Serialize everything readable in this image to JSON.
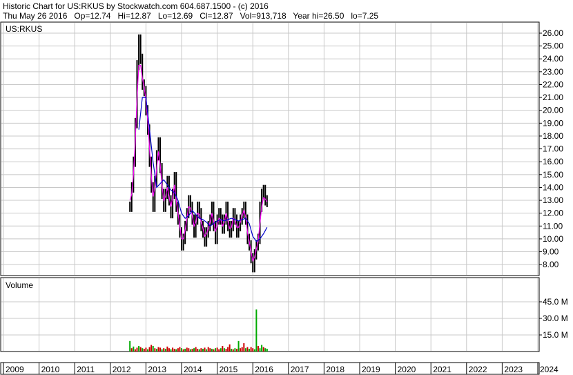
{
  "header": {
    "line1": "Historic Chart for US:RKUS by Stockwatch.com 604.687.1500 - (c) 2016",
    "line2": "Thu May 26 2016   Op=12.74   Hi=12.87   Lo=12.69   Cl=12.87   Vol=913,718   Year hi=26.50   lo=7.25"
  },
  "colors": {
    "grid": "#c8c8c8",
    "price_bars": "#000000",
    "ma_short": "#ff00ff",
    "ma_long": "#0000cc",
    "volume_up": "#00aa00",
    "volume_down": "#cc0000"
  },
  "chart_data": [
    {
      "type": "line",
      "title": "US:RKUS",
      "ylim": [
        7,
        26.8
      ],
      "y_ticks": [
        "26.00",
        "25.00",
        "24.00",
        "23.00",
        "22.00",
        "21.00",
        "20.00",
        "19.00",
        "18.00",
        "17.00",
        "16.00",
        "15.00",
        "14.00",
        "13.00",
        "12.00",
        "11.00",
        "10.00",
        "9.00",
        "8.00"
      ],
      "x_ticks": [
        "2009",
        "2010",
        "2011",
        "2012",
        "2013",
        "2014",
        "2015",
        "2016",
        "2017",
        "2018",
        "2019",
        "2020",
        "2021",
        "2022",
        "2023",
        "2024"
      ],
      "grid": true,
      "series": [
        {
          "kind": "price",
          "x": [
            2012.55,
            2012.6,
            2012.65,
            2012.7,
            2012.75,
            2012.8,
            2012.85,
            2012.9,
            2012.95,
            2013.0,
            2013.05,
            2013.1,
            2013.15,
            2013.2,
            2013.25,
            2013.3,
            2013.35,
            2013.4,
            2013.45,
            2013.5,
            2013.55,
            2013.6,
            2013.65,
            2013.7,
            2013.75,
            2013.8,
            2013.85,
            2013.9,
            2013.95,
            2014.0,
            2014.05,
            2014.1,
            2014.15,
            2014.2,
            2014.25,
            2014.3,
            2014.35,
            2014.4,
            2014.45,
            2014.5,
            2014.55,
            2014.6,
            2014.65,
            2014.7,
            2014.75,
            2014.8,
            2014.85,
            2014.9,
            2014.95,
            2015.0,
            2015.05,
            2015.1,
            2015.15,
            2015.2,
            2015.25,
            2015.3,
            2015.35,
            2015.4,
            2015.45,
            2015.5,
            2015.55,
            2015.6,
            2015.65,
            2015.7,
            2015.75,
            2015.8,
            2015.85,
            2015.9,
            2015.95,
            2016.0,
            2016.05,
            2016.1,
            2016.15,
            2016.2,
            2016.25,
            2016.3,
            2016.35,
            2016.4
          ],
          "y": [
            12.5,
            14.0,
            16.0,
            19.0,
            23.5,
            25.5,
            24.0,
            22.0,
            21.5,
            20.0,
            18.5,
            16.0,
            14.0,
            12.5,
            14.5,
            16.5,
            17.5,
            15.5,
            13.5,
            12.5,
            13.5,
            14.5,
            13.0,
            12.0,
            13.5,
            14.8,
            12.5,
            11.5,
            10.5,
            9.5,
            10.0,
            11.0,
            12.0,
            13.0,
            12.5,
            11.5,
            10.5,
            11.5,
            12.5,
            12.0,
            11.0,
            10.5,
            9.8,
            10.5,
            11.0,
            11.5,
            12.5,
            11.0,
            10.0,
            11.5,
            12.0,
            11.5,
            10.8,
            11.5,
            12.5,
            11.0,
            10.5,
            11.0,
            12.0,
            11.5,
            10.5,
            11.0,
            11.5,
            12.0,
            12.5,
            11.5,
            10.0,
            9.5,
            8.5,
            7.8,
            8.8,
            9.5,
            10.0,
            12.5,
            13.5,
            13.8,
            13.0,
            12.87
          ]
        },
        {
          "kind": "ma_short",
          "x": [
            2012.55,
            2012.6,
            2012.65,
            2012.7,
            2012.75,
            2012.8,
            2012.85,
            2012.9,
            2012.95,
            2013.0,
            2013.05,
            2013.1,
            2013.15,
            2013.2,
            2013.25,
            2013.3,
            2013.35,
            2013.4,
            2013.45,
            2013.5,
            2013.55,
            2013.6,
            2013.65,
            2013.7,
            2013.75,
            2013.8,
            2013.85,
            2013.9,
            2013.95,
            2014.0,
            2014.05,
            2014.1,
            2014.15,
            2014.2,
            2014.25,
            2014.3,
            2014.35,
            2014.4,
            2014.45,
            2014.5,
            2014.55,
            2014.6,
            2014.65,
            2014.7,
            2014.75,
            2014.8,
            2014.85,
            2014.9,
            2014.95,
            2015.0,
            2015.05,
            2015.1,
            2015.15,
            2015.2,
            2015.25,
            2015.3,
            2015.35,
            2015.4,
            2015.45,
            2015.5,
            2015.55,
            2015.6,
            2015.65,
            2015.7,
            2015.75,
            2015.8,
            2015.85,
            2015.9,
            2015.95,
            2016.0,
            2016.05,
            2016.1,
            2016.15,
            2016.2,
            2016.25,
            2016.3,
            2016.35,
            2016.4
          ],
          "y": [
            13.0,
            13.5,
            15.0,
            17.5,
            21.0,
            23.5,
            23.5,
            22.5,
            21.8,
            20.8,
            19.2,
            17.0,
            15.0,
            13.3,
            14.0,
            15.5,
            16.8,
            15.8,
            14.2,
            13.0,
            13.3,
            14.0,
            13.3,
            12.5,
            13.2,
            14.2,
            13.0,
            12.0,
            11.0,
            10.0,
            10.0,
            10.7,
            11.6,
            12.5,
            12.4,
            11.8,
            11.0,
            11.3,
            12.0,
            11.9,
            11.3,
            10.8,
            10.2,
            10.4,
            10.8,
            11.3,
            12.0,
            11.4,
            10.6,
            11.0,
            11.6,
            11.5,
            11.0,
            11.3,
            12.0,
            11.4,
            10.8,
            10.9,
            11.6,
            11.5,
            10.9,
            10.9,
            11.3,
            11.8,
            12.2,
            11.7,
            10.5,
            9.8,
            9.0,
            8.3,
            8.6,
            9.2,
            9.8,
            11.2,
            12.5,
            13.2,
            13.1,
            12.9
          ]
        },
        {
          "kind": "ma_long",
          "x": [
            2012.8,
            2012.9,
            2013.0,
            2013.1,
            2013.2,
            2013.3,
            2013.4,
            2013.5,
            2013.6,
            2013.7,
            2013.8,
            2013.9,
            2014.0,
            2014.1,
            2014.2,
            2014.3,
            2014.4,
            2014.5,
            2014.6,
            2014.7,
            2014.8,
            2014.9,
            2015.0,
            2015.1,
            2015.2,
            2015.3,
            2015.4,
            2015.5,
            2015.6,
            2015.7,
            2015.8,
            2015.9,
            2016.0,
            2016.1,
            2016.2,
            2016.3,
            2016.4
          ],
          "y": [
            18.5,
            21.0,
            21.0,
            18.5,
            16.0,
            14.0,
            14.3,
            14.6,
            14.2,
            13.8,
            13.6,
            13.0,
            12.0,
            11.6,
            11.8,
            12.2,
            11.9,
            11.6,
            11.5,
            11.3,
            11.0,
            11.2,
            11.4,
            11.5,
            11.4,
            11.5,
            11.6,
            11.5,
            11.4,
            11.5,
            11.6,
            11.2,
            10.2,
            9.8,
            10.0,
            10.4,
            10.9
          ]
        }
      ]
    },
    {
      "type": "bar",
      "title": "Volume",
      "ylim": [
        0,
        50
      ],
      "y_unit": "M",
      "y_ticks": [
        "45.0 M",
        "30.0 M",
        "15.0 M"
      ],
      "grid": true,
      "series": [
        {
          "kind": "volume",
          "x": [
            2012.55,
            2012.6,
            2012.65,
            2012.7,
            2012.75,
            2012.8,
            2012.85,
            2012.9,
            2012.95,
            2013.0,
            2013.05,
            2013.1,
            2013.15,
            2013.2,
            2013.25,
            2013.3,
            2013.35,
            2013.4,
            2013.45,
            2013.5,
            2013.55,
            2013.6,
            2013.65,
            2013.7,
            2013.75,
            2013.8,
            2013.85,
            2013.9,
            2013.95,
            2014.0,
            2014.05,
            2014.1,
            2014.15,
            2014.2,
            2014.25,
            2014.3,
            2014.35,
            2014.4,
            2014.45,
            2014.5,
            2014.55,
            2014.6,
            2014.65,
            2014.7,
            2014.75,
            2014.8,
            2014.85,
            2014.9,
            2014.95,
            2015.0,
            2015.05,
            2015.1,
            2015.15,
            2015.2,
            2015.25,
            2015.3,
            2015.35,
            2015.4,
            2015.45,
            2015.5,
            2015.55,
            2015.6,
            2015.65,
            2015.7,
            2015.75,
            2015.8,
            2015.85,
            2015.9,
            2015.95,
            2016.0,
            2016.05,
            2016.1,
            2016.15,
            2016.2,
            2016.25,
            2016.3,
            2016.35,
            2016.4
          ],
          "values": [
            9.5,
            3.0,
            4.5,
            2.0,
            3.5,
            5.0,
            4.0,
            3.0,
            2.5,
            3.5,
            2.0,
            4.0,
            6.0,
            5.0,
            3.0,
            2.5,
            4.0,
            3.5,
            2.0,
            3.0,
            2.5,
            4.5,
            3.0,
            2.0,
            3.5,
            2.5,
            2.0,
            3.0,
            4.0,
            3.0,
            2.0,
            2.5,
            3.5,
            3.0,
            2.0,
            2.5,
            3.0,
            4.0,
            2.5,
            2.0,
            3.0,
            2.5,
            3.5,
            2.0,
            4.0,
            3.0,
            2.5,
            2.0,
            3.0,
            3.5,
            2.0,
            3.0,
            5.0,
            3.0,
            2.5,
            4.0,
            6.5,
            2.5,
            2.0,
            3.0,
            2.5,
            9.5,
            3.0,
            4.0,
            7.5,
            3.0,
            4.0,
            2.5,
            4.0,
            3.0,
            2.0,
            38.0,
            5.0,
            3.0,
            6.0,
            4.0,
            3.0,
            2.5
          ],
          "up": [
            true,
            false,
            true,
            false,
            false,
            true,
            false,
            true,
            false,
            false,
            true,
            false,
            false,
            true,
            false,
            true,
            false,
            false,
            true,
            false,
            true,
            false,
            false,
            true,
            false,
            false,
            true,
            false,
            false,
            true,
            false,
            true,
            false,
            false,
            true,
            false,
            true,
            false,
            false,
            true,
            false,
            true,
            false,
            true,
            false,
            false,
            true,
            false,
            true,
            false,
            false,
            true,
            false,
            true,
            false,
            false,
            false,
            true,
            false,
            true,
            false,
            true,
            false,
            false,
            false,
            true,
            false,
            true,
            false,
            false,
            true,
            true,
            false,
            true,
            true,
            false,
            true,
            true
          ]
        }
      ]
    }
  ]
}
